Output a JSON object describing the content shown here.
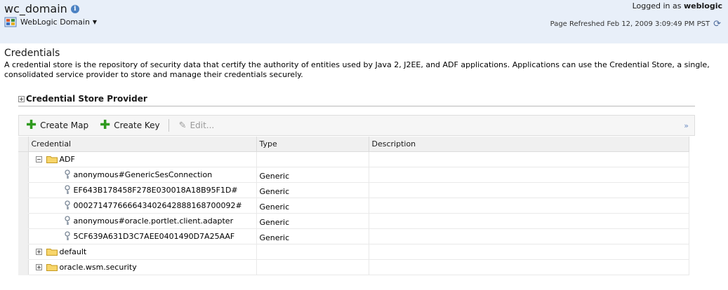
{
  "header": {
    "domain_title": "wc_domain",
    "domain_menu_label": "WebLogic Domain",
    "logged_in_prefix": "Logged in as",
    "logged_in_user": "weblogic",
    "page_refreshed": "Page Refreshed Feb 12, 2009 3:09:49 PM PST"
  },
  "section": {
    "title": "Credentials",
    "description": "A credential store is the repository of security data that certify the authority of entities used by Java 2, J2EE, and ADF applications. Applications can use the Credential Store, a single, consolidated service provider to store and manage their credentials securely.",
    "provider_label": "Credential Store Provider"
  },
  "toolbar": {
    "create_map": "Create Map",
    "create_key": "Create Key",
    "edit": "Edit...",
    "more": "»"
  },
  "table": {
    "columns": [
      "Credential",
      "Type",
      "Description"
    ],
    "rows": [
      {
        "kind": "map",
        "label": "ADF",
        "expanded": true,
        "type": "",
        "description": ""
      },
      {
        "kind": "key",
        "label": "anonymous#GenericSesConnection",
        "type": "Generic",
        "description": ""
      },
      {
        "kind": "key",
        "label": "EF643B178458F278E030018A18B95F1D#",
        "type": "Generic",
        "description": ""
      },
      {
        "kind": "key",
        "label": "000271477666643402642888168700092#",
        "type": "Generic",
        "description": ""
      },
      {
        "kind": "key",
        "label": "anonymous#oracle.portlet.client.adapter",
        "type": "Generic",
        "description": ""
      },
      {
        "kind": "key",
        "label": "5CF639A631D3C7AEE0401490D7A25AAF",
        "type": "Generic",
        "description": ""
      },
      {
        "kind": "map",
        "label": "default",
        "expanded": false,
        "type": "",
        "description": ""
      },
      {
        "kind": "map",
        "label": "oracle.wsm.security",
        "expanded": false,
        "type": "",
        "description": ""
      }
    ]
  },
  "icons": {
    "info": "info-icon",
    "weblogic_domain": "weblogic-domain-icon",
    "refresh": "refresh-icon",
    "create": "green-plus-icon",
    "edit": "pencil-icon",
    "folder": "folder-icon",
    "key": "key-icon"
  }
}
